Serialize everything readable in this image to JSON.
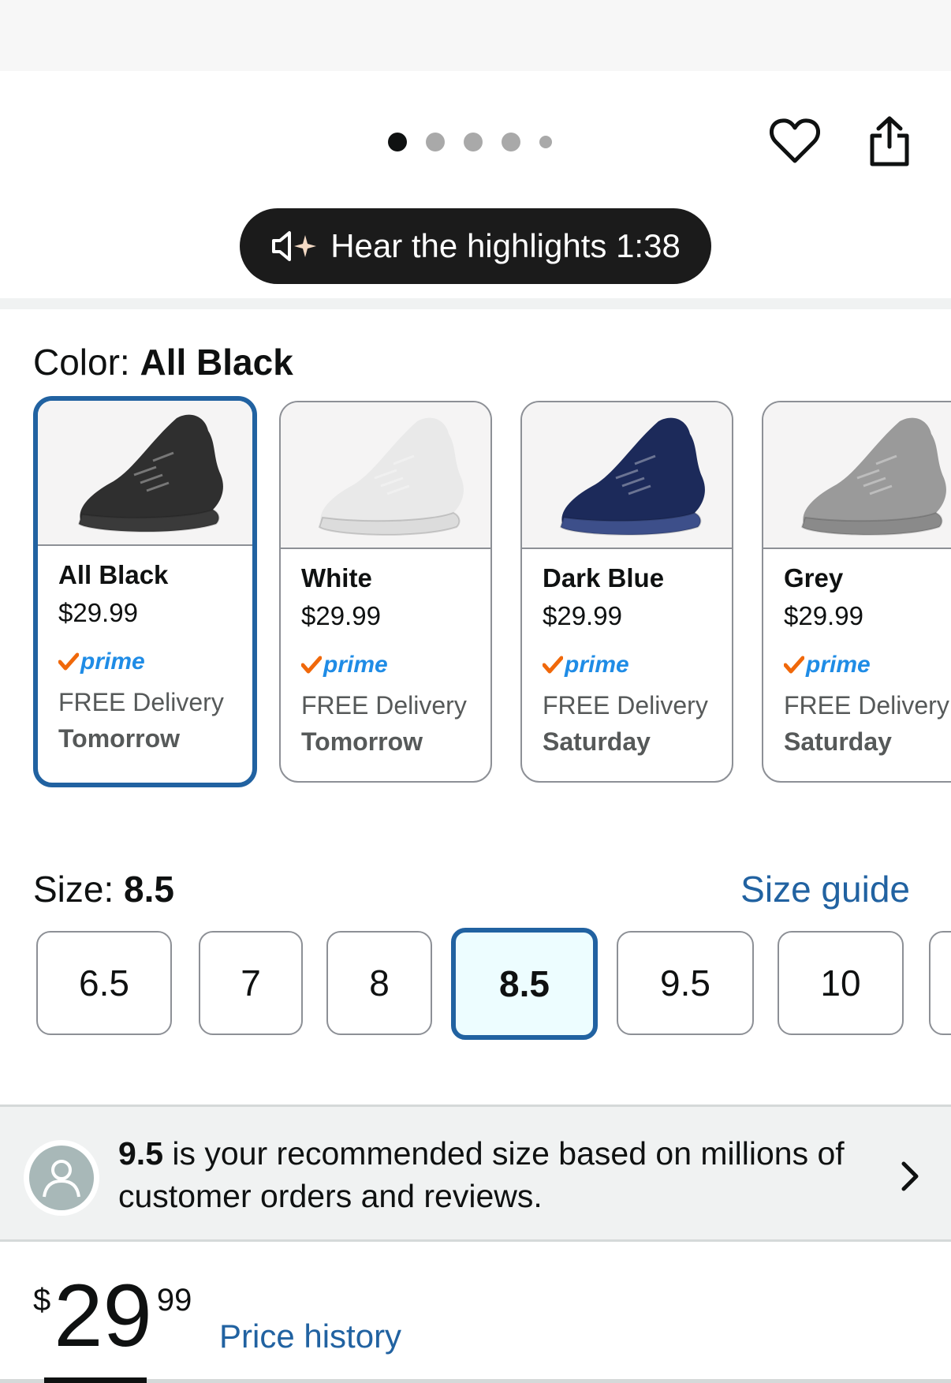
{
  "header": {
    "hear_highlights_label": "Hear the highlights 1:38"
  },
  "carousel": {
    "dot_count": 5,
    "active_index": 0
  },
  "color": {
    "label": "Color:",
    "selected": "All Black",
    "options": [
      {
        "name": "All Black",
        "price": "$29.99",
        "prime": "prime",
        "delivery": "FREE Delivery",
        "day": "Tomorrow",
        "shoe_color": "#2f2f2f",
        "sole_color": "#3a3a3a",
        "selected": true
      },
      {
        "name": "White",
        "price": "$29.99",
        "prime": "prime",
        "delivery": "FREE Delivery",
        "day": "Tomorrow",
        "shoe_color": "#e9e9e9",
        "sole_color": "#dcdcdc",
        "selected": false
      },
      {
        "name": "Dark Blue",
        "price": "$29.99",
        "prime": "prime",
        "delivery": "FREE Delivery",
        "day": "Saturday",
        "shoe_color": "#1c2a5a",
        "sole_color": "#3d4f8a",
        "selected": false
      },
      {
        "name": "Grey",
        "price": "$29.99",
        "prime": "prime",
        "delivery": "FREE Delivery",
        "day": "Saturday",
        "shoe_color": "#9a9a9a",
        "sole_color": "#8a8a8a",
        "selected": false
      }
    ]
  },
  "size": {
    "label": "Size:",
    "selected": "8.5",
    "guide_label": "Size guide",
    "options": [
      "6.5",
      "7",
      "8",
      "8.5",
      "9.5",
      "10",
      ""
    ]
  },
  "recommendation": {
    "size": "9.5",
    "text": " is your recommended size based on millions of customer orders and reviews."
  },
  "price": {
    "symbol": "$",
    "whole": "29",
    "fraction": "99",
    "history_label": "Price history"
  },
  "colors": {
    "accent_blue": "#2162a1",
    "prime_blue": "#1f8ce6",
    "prime_check": "#f0680a"
  }
}
